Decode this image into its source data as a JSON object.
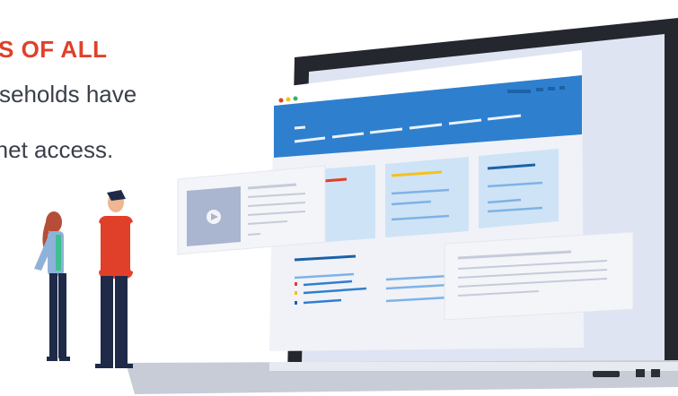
{
  "headline": {
    "text": "S OF ALL",
    "color": "#e0402a"
  },
  "lines": [
    "seholds have",
    "rnet access."
  ],
  "colors": {
    "accent_blue": "#2f7fcf",
    "accent_orange": "#e0402a",
    "accent_yellow": "#f3c21a",
    "screen_bg": "#dfe4f2",
    "laptop_frame": "#24272e"
  },
  "icons": [
    "play-icon"
  ]
}
